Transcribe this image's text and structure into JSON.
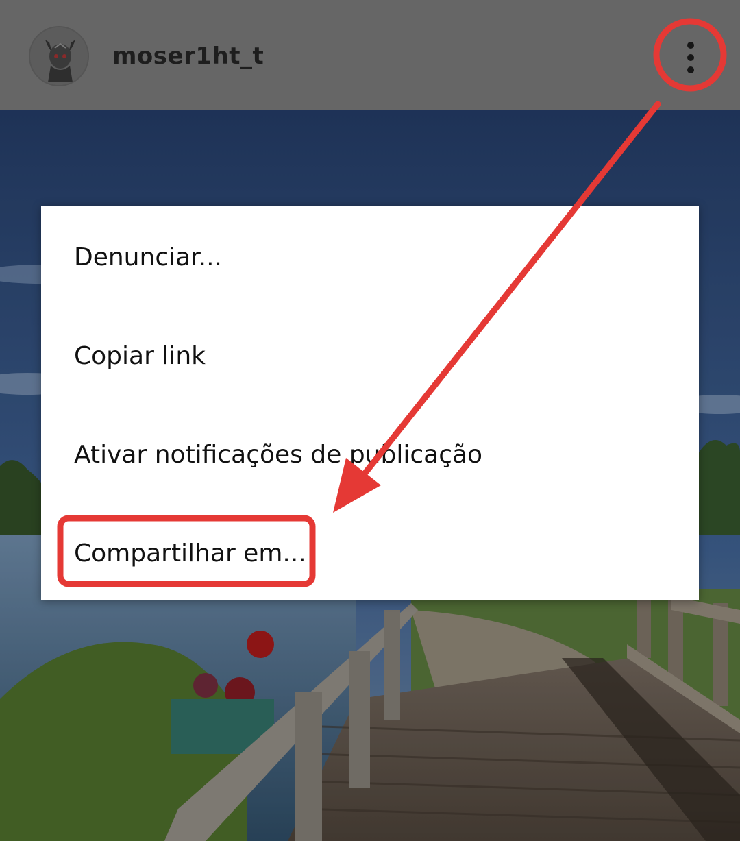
{
  "header": {
    "username": "moser1ht_t",
    "avatar_icon": "devil-avatar-icon",
    "more_icon": "more-vertical-icon"
  },
  "menu": {
    "items": [
      {
        "label": "Denunciar..."
      },
      {
        "label": "Copiar link"
      },
      {
        "label": "Ativar notificações de publicação"
      },
      {
        "label": "Compartilhar em..."
      }
    ]
  },
  "annotation": {
    "color": "#e53935"
  },
  "colors": {
    "header_bg": "#666666",
    "menu_bg": "#ffffff"
  }
}
